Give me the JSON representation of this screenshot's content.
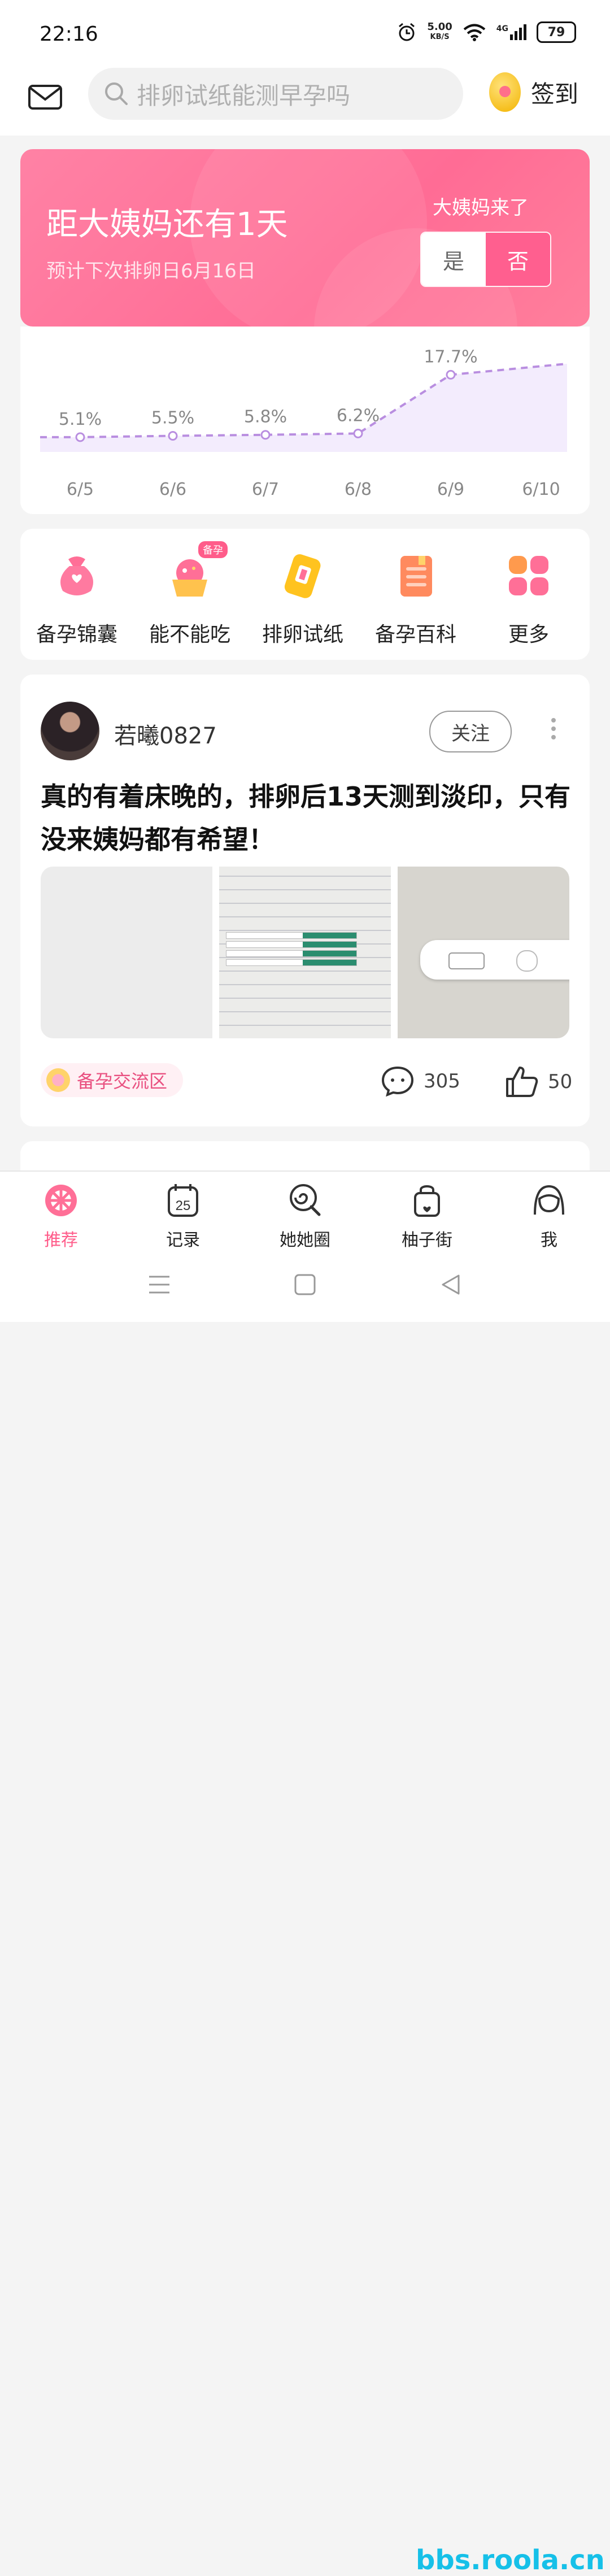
{
  "status_bar": {
    "time": "22:16",
    "net_speed": "5.00",
    "net_unit": "KB/S",
    "network": "4G",
    "battery": "79"
  },
  "header": {
    "search_placeholder": "排卵试纸能测早孕吗",
    "signin_label": "签到"
  },
  "period_card": {
    "title": "距大姨妈还有1天",
    "subtitle": "预计下次排卵日6月16日",
    "question": "大姨妈来了",
    "yes_label": "是",
    "no_label": "否",
    "selected": "否"
  },
  "chart_data": {
    "type": "line",
    "x": [
      "6/5",
      "6/6",
      "6/7",
      "6/8",
      "6/9",
      "6/10"
    ],
    "series": [
      {
        "values": [
          5.1,
          5.5,
          5.8,
          6.2,
          17.7,
          21.0
        ],
        "labels": [
          "5.1%",
          "5.5%",
          "5.8%",
          "6.2%",
          "17.7%",
          ""
        ]
      }
    ],
    "line_color": "#b98ee0",
    "fill_color": "#f3ecfd",
    "ylim": [
      0,
      22
    ]
  },
  "tools": [
    {
      "label": "备孕锦囊",
      "icon": "lucky-bag-icon"
    },
    {
      "label": "能不能吃",
      "icon": "cupcake-icon",
      "badge": "备孕"
    },
    {
      "label": "排卵试纸",
      "icon": "test-strip-icon"
    },
    {
      "label": "备孕百科",
      "icon": "book-icon"
    },
    {
      "label": "更多",
      "icon": "grid-icon"
    }
  ],
  "post": {
    "username": "若曦0827",
    "follow_label": "关注",
    "title": "真的有着床晚的，排卵后13天测到淡印，只有没来姨妈都有希望！",
    "tag": "备孕交流区",
    "comments": "305",
    "likes": "50"
  },
  "tabs": [
    {
      "label": "推荐",
      "icon": "grapefruit-icon",
      "active": true
    },
    {
      "label": "记录",
      "icon": "calendar-icon",
      "badge": "25"
    },
    {
      "label": "她她圈",
      "icon": "lollipop-icon"
    },
    {
      "label": "柚子街",
      "icon": "shopping-bag-icon"
    },
    {
      "label": "我",
      "icon": "profile-icon"
    }
  ],
  "watermark": "bbs.roola.cn",
  "colors": {
    "accent": "#ff5c8a",
    "hero_gradient_start": "#ff82a5",
    "hero_gradient_end": "#ff6c95"
  }
}
